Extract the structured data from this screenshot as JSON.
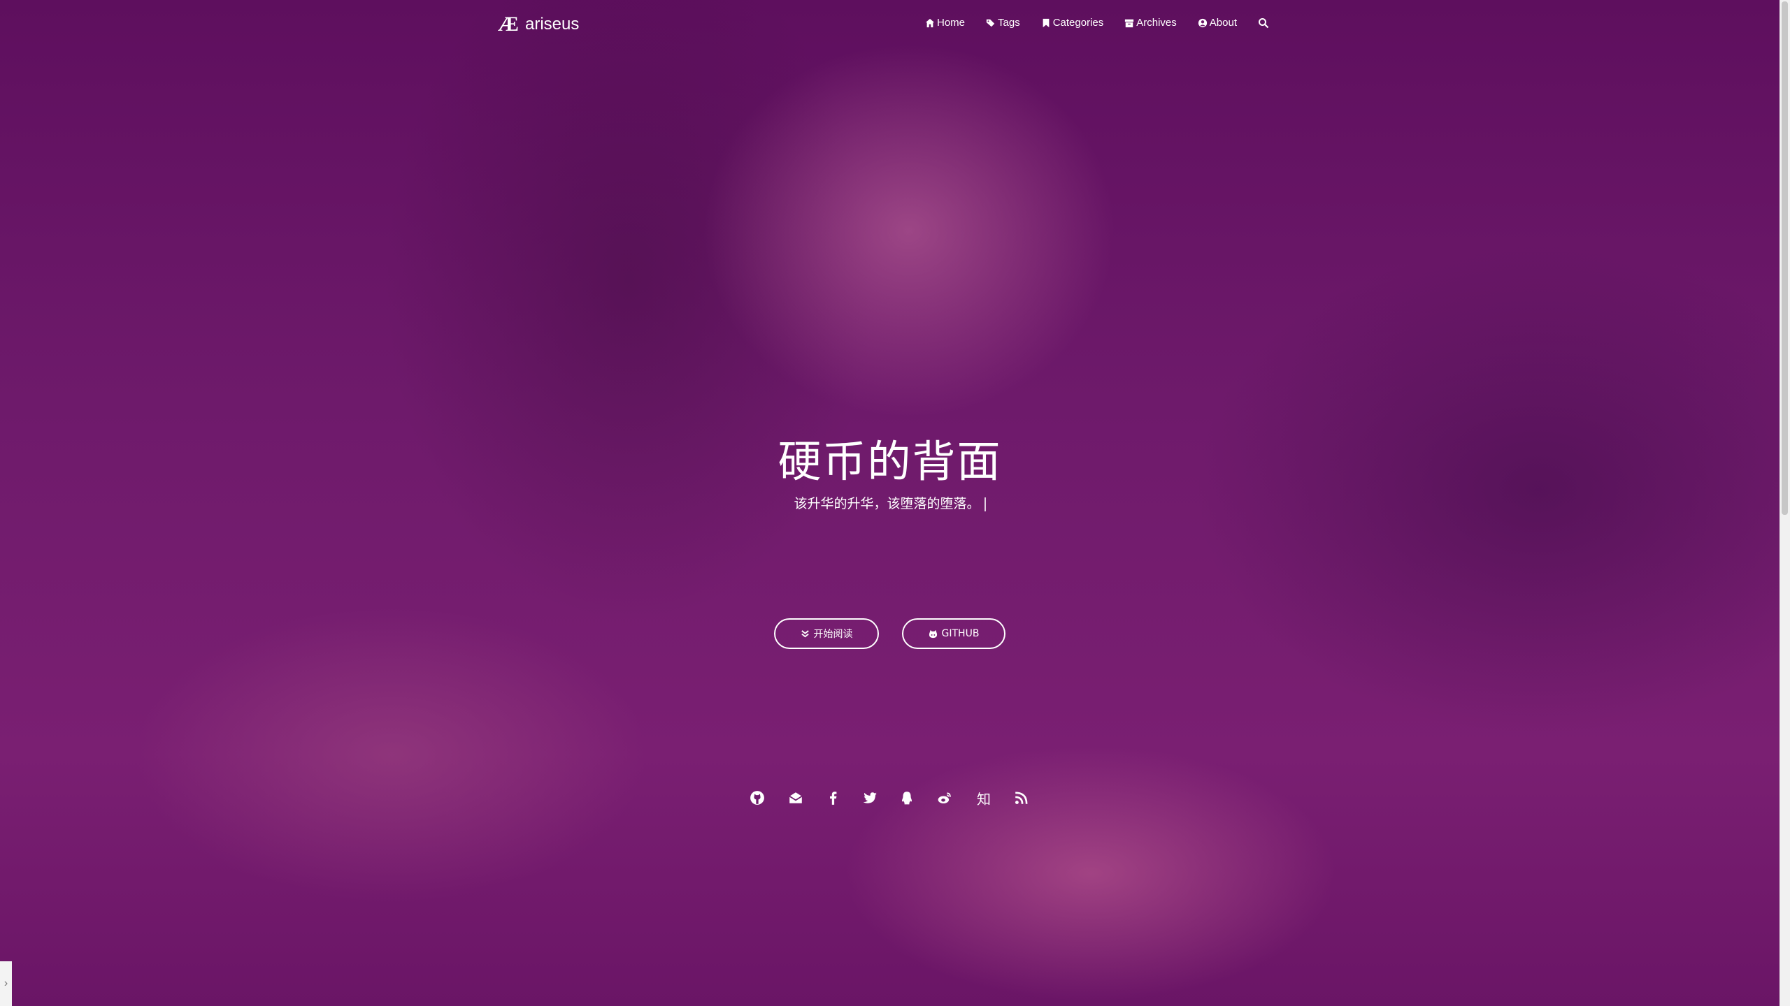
{
  "brand": {
    "logo": "Æ",
    "name": "ariseus"
  },
  "nav": {
    "items": [
      {
        "label": "Home",
        "icon": "home-icon"
      },
      {
        "label": "Tags",
        "icon": "tags-icon"
      },
      {
        "label": "Categories",
        "icon": "bookmark-icon"
      },
      {
        "label": "Archives",
        "icon": "archive-icon"
      },
      {
        "label": "About",
        "icon": "user-circle-icon"
      }
    ],
    "search_icon": "search-icon"
  },
  "hero": {
    "title": "硬币的背面",
    "subtitle": "该升华的升华，该堕落的堕落。"
  },
  "buttons": {
    "read": "开始阅读",
    "github": "GITHUB"
  },
  "social": {
    "zhihu": "知",
    "icons": [
      "github-icon",
      "email-icon",
      "facebook-icon",
      "twitter-icon",
      "qq-icon",
      "weibo-icon",
      "zhihu-icon",
      "rss-icon"
    ]
  },
  "side_toggle": "›",
  "colors": {
    "overlay": "#6e1a6b",
    "text": "#ffffff"
  }
}
